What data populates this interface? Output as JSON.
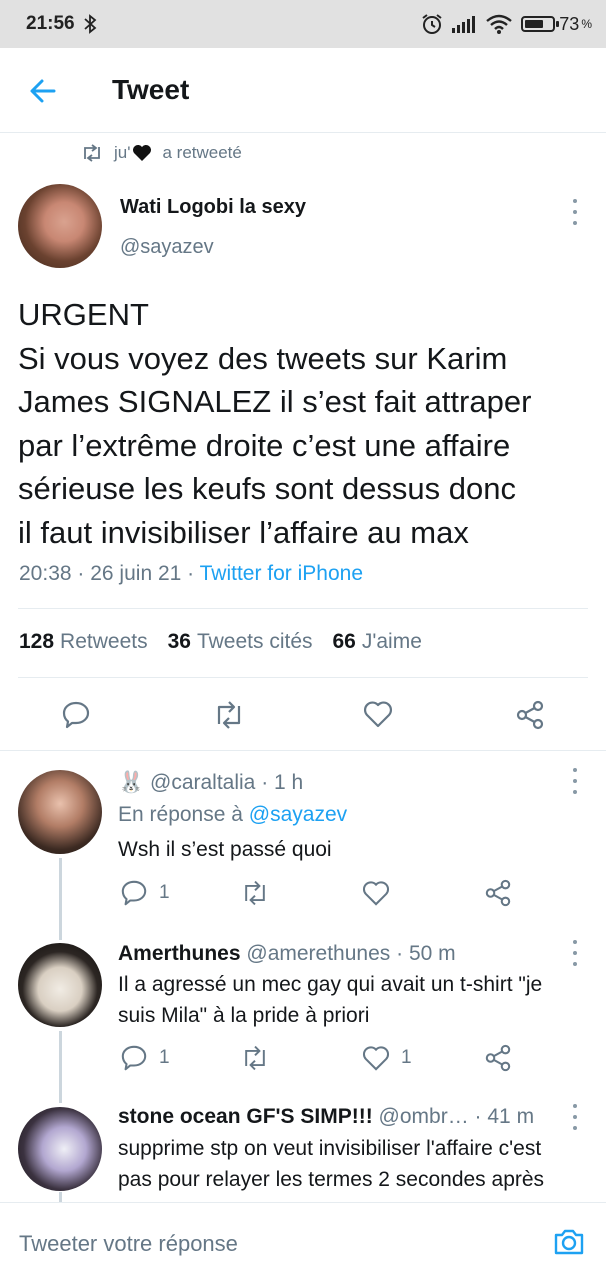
{
  "status_bar": {
    "time": "21:56",
    "battery_pct": "73",
    "battery_unit": "%",
    "battery_level": 0.73
  },
  "header": {
    "title": "Tweet"
  },
  "retweet_context": {
    "label_prefix": "ju'",
    "label_suffix": "a retweeté"
  },
  "main_tweet": {
    "author_name": "Wati Logobi la sexy",
    "handle": "@sayazev",
    "text_lines": [
      "URGENT",
      "Si vous voyez des tweets sur Karim",
      "James SIGNALEZ il s’est fait attraper",
      "par l’extrême droite c’est une affaire",
      "sérieuse les keufs sont dessus donc",
      "il faut invisibiliser l’affaire au max"
    ],
    "time": "20:38",
    "date": "26 juin 21",
    "source": "Twitter for iPhone",
    "stats": {
      "retweets_count": "128",
      "retweets_label": "Retweets",
      "quotes_count": "36",
      "quotes_label": "Tweets cités",
      "likes_count": "66",
      "likes_label": "J'aime"
    }
  },
  "replies": [
    {
      "emoji": "🐰",
      "handle": "@caraltalia",
      "age": "1 h",
      "reply_to_prefix": "En réponse à",
      "reply_to": "@sayazev",
      "text_lines": [
        "Wsh il s’est passé quoi"
      ],
      "reply_count": "1",
      "like_count": ""
    },
    {
      "name": "Amerthunes",
      "handle": "@amerethunes",
      "age": "50 m",
      "text_lines": [
        "Il a agressé un mec gay qui avait un t-shirt \"je",
        "suis Mila\" à la pride à priori"
      ],
      "reply_count": "1",
      "like_count": "1"
    },
    {
      "name": "stone ocean GF'S SIMP!!!",
      "handle": "@ombr…",
      "age": "41 m",
      "text_lines": [
        "supprime stp on veut invisibiliser l'affaire c'est",
        "pas pour relayer les termes 2 secondes après"
      ]
    }
  ],
  "composer": {
    "placeholder": "Tweeter votre réponse"
  }
}
